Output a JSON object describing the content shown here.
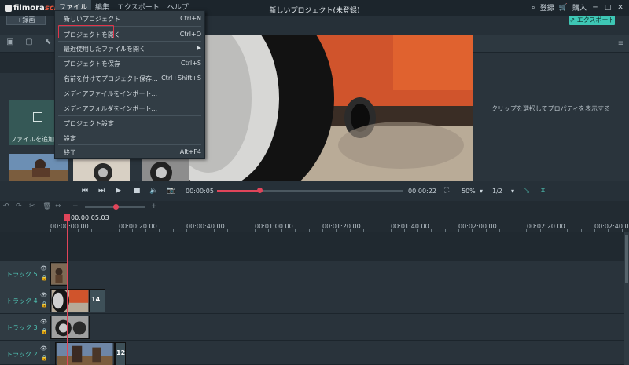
{
  "app": {
    "logo_text": "filmora",
    "logo_suffix": "scrn",
    "title": "新しいプロジェクト(未登録)",
    "login": "登録",
    "buy": "購入",
    "export": "エクスポート",
    "record": "+録画"
  },
  "menubar": [
    "ファイル",
    "編集",
    "エクスポート",
    "ヘルプ"
  ],
  "file_menu": {
    "items": [
      {
        "label": "新しいプロジェクト",
        "shortcut": "Ctrl+N"
      },
      {
        "label": "プロジェクトを開く",
        "shortcut": "Ctrl+O"
      },
      {
        "label": "最近使用したファイルを開く",
        "shortcut": ""
      },
      {
        "label": "プロジェクトを保存",
        "shortcut": "Ctrl+S"
      },
      {
        "label": "名前を付けてプロジェクト保存...",
        "shortcut": "Ctrl+Shift+S"
      },
      {
        "label": "メディアファイルをインポート...",
        "shortcut": ""
      },
      {
        "label": "メディアフォルダをインポート...",
        "shortcut": ""
      },
      {
        "label": "プロジェクト設定",
        "shortcut": ""
      },
      {
        "label": "設定",
        "shortcut": ""
      },
      {
        "label": "終了",
        "shortcut": "Alt+F4"
      }
    ]
  },
  "media": {
    "add_file": "ファイルを追加"
  },
  "properties": {
    "hint": "クリップを選択してプロパティを表示する"
  },
  "playback": {
    "current_time": "00:00:05",
    "total_time": "00:00:22",
    "zoom": "50%",
    "quality": "1/2",
    "progress": 0.23
  },
  "timeline": {
    "playhead_time": "00:00:05.03",
    "ruler": [
      "00:00:00.00",
      "00:00:20.00",
      "00:00:40.00",
      "00:01:00.00",
      "00:01:20.00",
      "00:01:40.00",
      "00:02:00.00",
      "00:02:20.00",
      "00:02:40.0"
    ],
    "tracks": [
      {
        "label": "トラック 5"
      },
      {
        "label": "トラック 4",
        "clip_count": "14"
      },
      {
        "label": "トラック 3"
      },
      {
        "label": "トラック 2",
        "clip_count": "12"
      }
    ]
  },
  "colors": {
    "accent": "#3ec7b5",
    "playhead": "#e0455a",
    "highlight": "#e0344a"
  }
}
